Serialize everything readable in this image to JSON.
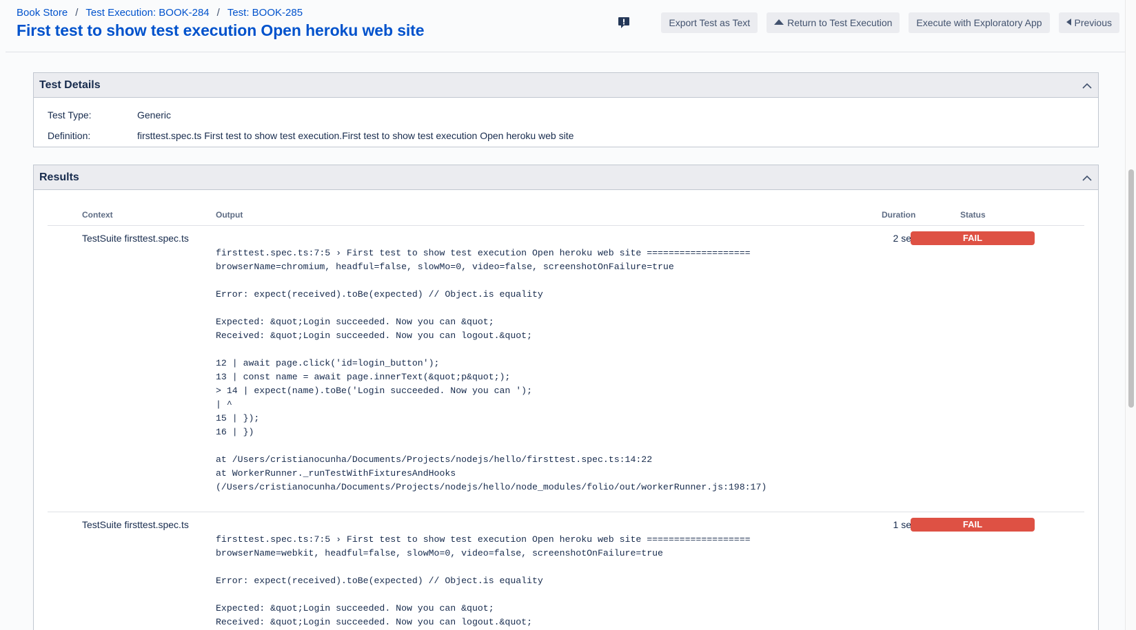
{
  "breadcrumb": {
    "items": [
      "Book Store",
      "Test Execution: BOOK-284",
      "Test: BOOK-285"
    ],
    "separator": "/"
  },
  "page_title": "First test to show test execution Open heroku web site",
  "toolbar": {
    "feedback_icon": "feedback-icon",
    "export_label": "Export Test as Text",
    "return_label": "Return to Test Execution",
    "exploratory_label": "Execute with Exploratory App",
    "previous_label": "Previous"
  },
  "details": {
    "title": "Test Details",
    "type_label": "Test Type:",
    "type_value": "Generic",
    "definition_label": "Definition:",
    "definition_value": "firsttest.spec.ts First test to show test execution.First test to show test execution Open heroku web site"
  },
  "results": {
    "title": "Results",
    "columns": {
      "context": "Context",
      "output": "Output",
      "duration": "Duration",
      "status": "Status"
    },
    "rows": [
      {
        "context": "TestSuite firsttest.spec.ts",
        "duration": "2 sec",
        "status": "FAIL",
        "output": "firsttest.spec.ts:7:5 › First test to show test execution Open heroku web site ===================\nbrowserName=chromium, headful=false, slowMo=0, video=false, screenshotOnFailure=true\n\nError: expect(received).toBe(expected) // Object.is equality\n\nExpected: &quot;Login succeeded. Now you can &quot;\nReceived: &quot;Login succeeded. Now you can logout.&quot;\n\n12 | await page.click('id=login_button');\n13 | const name = await page.innerText(&quot;p&quot;);\n> 14 | expect(name).toBe('Login succeeded. Now you can ');\n| ^\n15 | });\n16 | })\n\nat /Users/cristianocunha/Documents/Projects/nodejs/hello/firsttest.spec.ts:14:22\nat WorkerRunner._runTestWithFixturesAndHooks\n(/Users/cristianocunha/Documents/Projects/nodejs/hello/node_modules/folio/out/workerRunner.js:198:17)"
      },
      {
        "context": "TestSuite firsttest.spec.ts",
        "duration": "1 sec",
        "status": "FAIL",
        "output": "firsttest.spec.ts:7:5 › First test to show test execution Open heroku web site ===================\nbrowserName=webkit, headful=false, slowMo=0, video=false, screenshotOnFailure=true\n\nError: expect(received).toBe(expected) // Object.is equality\n\nExpected: &quot;Login succeeded. Now you can &quot;\nReceived: &quot;Login succeeded. Now you can logout.&quot;"
      }
    ]
  },
  "colors": {
    "link": "#0052cc",
    "fail": "#de5144",
    "panel_header": "#ebecf0"
  }
}
